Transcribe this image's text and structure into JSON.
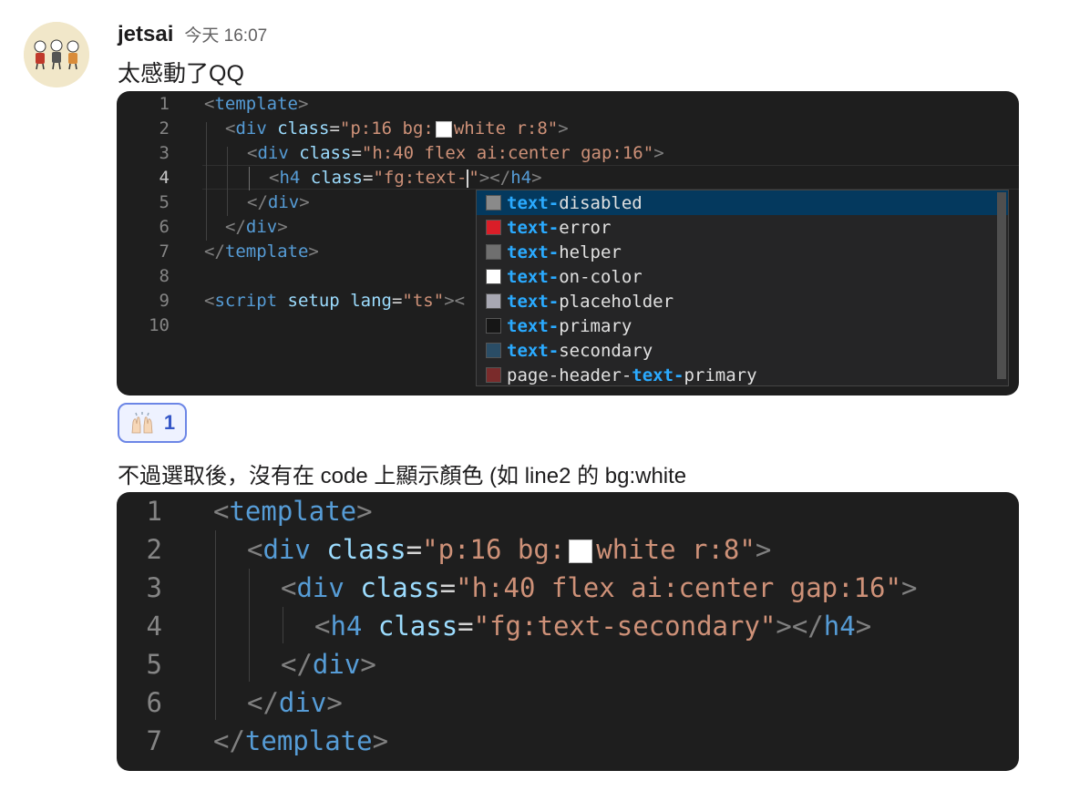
{
  "message": {
    "author": "jetsai",
    "timestamp": "今天 16:07",
    "text1": "太感動了QQ",
    "text2": "不過選取後，沒有在 code 上顯示顏色 (如 line2 的 bg:white",
    "avatar_icon": "three-characters-avatar-icon"
  },
  "reaction": {
    "emoji_icon": "raised-hands-emoji-icon",
    "count": "1"
  },
  "colors": {
    "editor_bg": "#1e1e1e",
    "tag": "#569cd6",
    "attr": "#9cdcfe",
    "string": "#ce9178",
    "suggest_selected": "#04395e",
    "suggest_match": "#2aaaff",
    "reaction_border": "#6c86e6"
  },
  "snippet1": {
    "line_numbers": [
      "1",
      "2",
      "3",
      "4",
      "5",
      "6",
      "7",
      "8",
      "9",
      "10"
    ],
    "l1": {
      "open": "<",
      "tag": "template",
      "close": ">"
    },
    "l2": {
      "open": "<",
      "tag": "div",
      "attr": "class",
      "eq": "=",
      "q1": "\"p:16 bg:",
      "val": "white r:8\"",
      "close": ">"
    },
    "l3": {
      "open": "<",
      "tag": "div",
      "attr": "class",
      "eq": "=",
      "val": "\"h:40 flex ai:center gap:16\"",
      "close": ">"
    },
    "l4": {
      "open": "<",
      "tag": "h4",
      "attr": "class",
      "eq": "=",
      "val": "\"fg:text-",
      "val2": "\"",
      "close": "></",
      "tag2": "h4",
      "close2": ">"
    },
    "l5": {
      "open": "</",
      "tag": "div",
      "close": ">"
    },
    "l6": {
      "open": "</",
      "tag": "div",
      "close": ">"
    },
    "l7": {
      "open": "</",
      "tag": "template",
      "close": ">"
    },
    "l9": {
      "open": "<",
      "tag": "script",
      "attr1": "setup",
      "attr2": "lang",
      "eq": "=",
      "val": "\"ts\"",
      "close": "><"
    }
  },
  "suggestions": [
    {
      "match": "text-",
      "rest": "disabled",
      "color": "#8a8a8a",
      "selected": true
    },
    {
      "match": "text-",
      "rest": "error",
      "color": "#da1e28"
    },
    {
      "match": "text-",
      "rest": "helper",
      "color": "#6f6f6f"
    },
    {
      "match": "text-",
      "rest": "on-color",
      "color": "#ffffff"
    },
    {
      "match": "text-",
      "rest": "placeholder",
      "color": "#a8a8b3"
    },
    {
      "match": "text-",
      "rest": "primary",
      "color": "#161616"
    },
    {
      "match": "text-",
      "rest": "secondary",
      "color": "#2a4d66"
    },
    {
      "prefix": "page-header-",
      "match": "text-",
      "rest": "primary",
      "color": "#7a2b2b"
    }
  ],
  "snippet2": {
    "line_numbers": [
      "1",
      "2",
      "3",
      "4",
      "5",
      "6",
      "7"
    ],
    "l1": {
      "open": "<",
      "tag": "template",
      "close": ">"
    },
    "l2": {
      "open": "<",
      "tag": "div",
      "attr": "class",
      "eq": "=",
      "q1": "\"p:16 bg:",
      "val": "white r:8\"",
      "close": ">"
    },
    "l3": {
      "open": "<",
      "tag": "div",
      "attr": "class",
      "eq": "=",
      "val": "\"h:40 flex ai:center gap:16\"",
      "close": ">"
    },
    "l4": {
      "open": "<",
      "tag": "h4",
      "attr": "class",
      "eq": "=",
      "val": "\"fg:text-secondary\"",
      "close": "></",
      "tag2": "h4",
      "close2": ">"
    },
    "l5": {
      "open": "</",
      "tag": "div",
      "close": ">"
    },
    "l6": {
      "open": "</",
      "tag": "div",
      "close": ">"
    },
    "l7": {
      "open": "</",
      "tag": "template",
      "close": ">"
    }
  }
}
